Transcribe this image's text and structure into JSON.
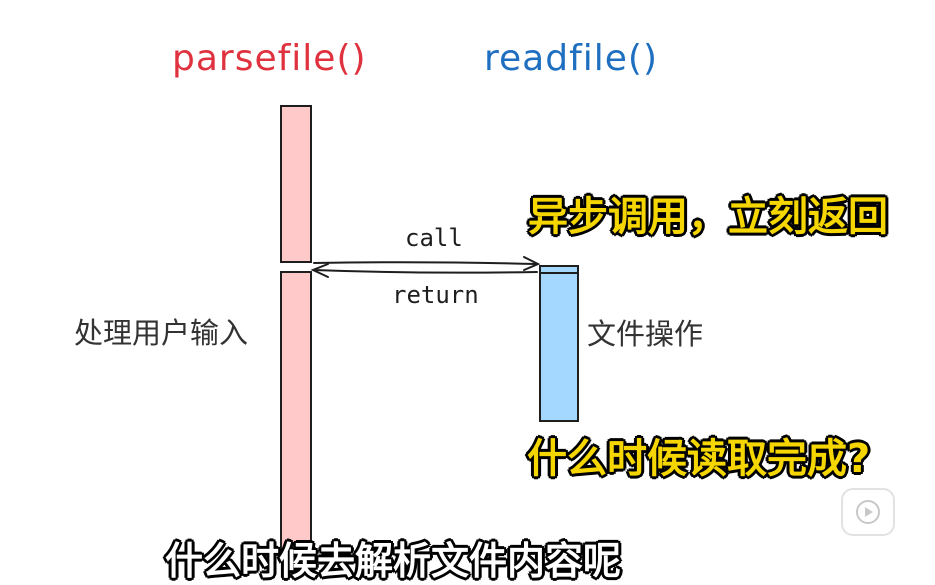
{
  "participants": {
    "parse": "parsefile()",
    "read": "readfile()"
  },
  "messages": {
    "call": "call",
    "return": "return"
  },
  "notes": {
    "parse_side": "处理用户输入",
    "read_side": "文件操作"
  },
  "captions": {
    "async": "异步调用，立刻返回",
    "when": "什么时候读取完成?",
    "bottom": "什么时候去解析文件内容呢"
  },
  "colors": {
    "parse": "#e0313f",
    "read": "#1f6fc1",
    "parse_bar": "#ffc9c9",
    "read_bar": "#a5d8ff",
    "caption": "#f5d600"
  },
  "icons": {
    "play": "play-icon"
  }
}
